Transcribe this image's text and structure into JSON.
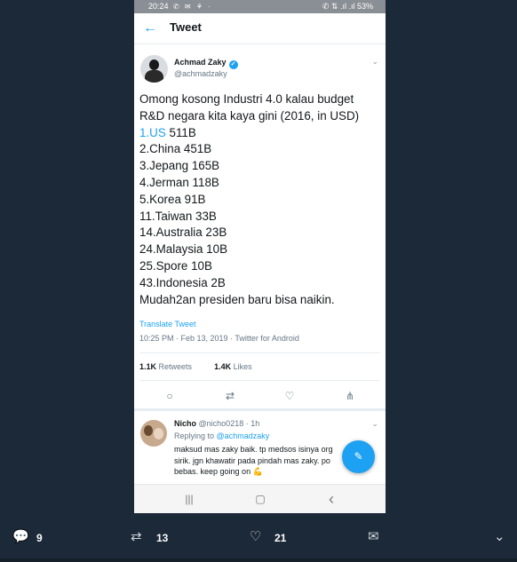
{
  "status_bar": {
    "time": "20:24",
    "left_icons": "✆ ✉ ⚘ ·",
    "right_text": "✆ ⇅ .ıl .ıl 53%"
  },
  "app_bar": {
    "back_icon": "←",
    "title": "Tweet"
  },
  "tweet": {
    "author_name": "Achmad Zaky",
    "verified_icon": "✓",
    "handle": "@achmadzaky",
    "menu_icon": "⌄",
    "lines": [
      "Omong kosong Industri 4.0 kalau budget",
      "R&D negara kita kaya gini (2016, in USD)",
      {
        "link": "1.US",
        "rest": " 511B"
      },
      "2.China 451B",
      "3.Jepang 165B",
      "4.Jerman 118B",
      "5.Korea 91B",
      "11.Taiwan 33B",
      "14.Australia 23B",
      "24.Malaysia 10B",
      "25.Spore 10B",
      "43.Indonesia 2B",
      "Mudah2an presiden baru bisa naikin."
    ],
    "translate_link": "Translate Tweet",
    "meta": "10:25 PM · Feb 13, 2019 · Twitter for Android",
    "retweets_count": "1.1K",
    "retweets_label": "Retweets",
    "likes_count": "1.4K",
    "likes_label": "Likes",
    "action_icons": {
      "reply": "○",
      "retweet": "⇄",
      "like": "♡",
      "share": "⋔"
    }
  },
  "reply": {
    "name": "Nicho",
    "handle_time": "@nicho0218 · 1h",
    "menu_icon": "⌄",
    "replying_prefix": "Replying to",
    "replying_handle": "@achmadzaky",
    "lines": [
      "maksud mas zaky baik. tp medsos isinya org",
      "sirik. jgn khawatir pada pindah mas zaky. po",
      "bebas. keep going on 💪"
    ]
  },
  "fab_icon": "✎",
  "android_nav": {
    "recents": "|||",
    "home": "▢",
    "back": "‹"
  },
  "bottom_actions": {
    "reply_icon": "💬",
    "reply_count": "9",
    "retweet_icon": "⇄",
    "retweet_count": "13",
    "like_icon": "♡",
    "like_count": "21",
    "message_icon": "✉",
    "more_icon": "⌄"
  }
}
